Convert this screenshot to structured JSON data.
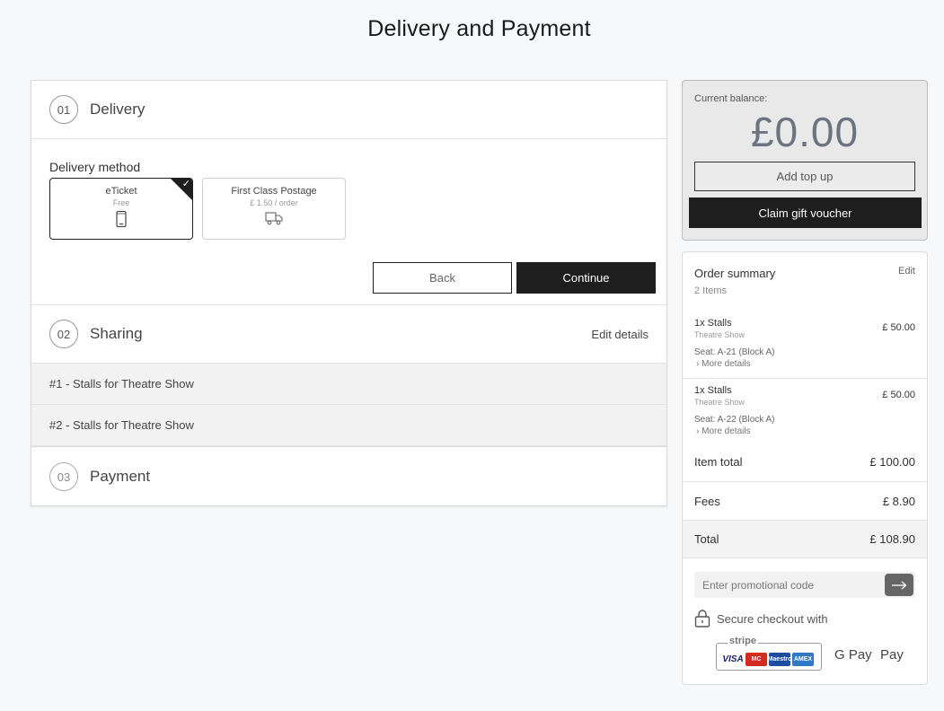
{
  "page": {
    "title": "Delivery and Payment"
  },
  "steps": {
    "delivery": {
      "number": "01",
      "title": "Delivery",
      "method_label": "Delivery method",
      "options": [
        {
          "name": "eTicket",
          "price": "Free",
          "icon": "mobile-phone-icon",
          "selected": true
        },
        {
          "name": "First Class Postage",
          "price": "£ 1.50 / order",
          "icon": "delivery-truck-icon",
          "selected": false
        }
      ],
      "back_label": "Back",
      "continue_label": "Continue"
    },
    "sharing": {
      "number": "02",
      "title": "Sharing",
      "edit_label": "Edit details",
      "tickets": [
        "#1 - Stalls for Theatre Show",
        "#2 - Stalls for Theatre Show"
      ]
    },
    "payment": {
      "number": "03",
      "title": "Payment"
    }
  },
  "balance": {
    "label": "Current balance:",
    "amount": "£0.00",
    "topup_label": "Add top up",
    "voucher_label": "Claim gift voucher"
  },
  "order_summary": {
    "title": "Order summary",
    "edit_label": "Edit",
    "count": "2 Items",
    "items": [
      {
        "name": "1x Stalls",
        "show": "Theatre Show",
        "seat": "Seat: A-21 (Block A)",
        "more": "More details",
        "price": "£ 50.00"
      },
      {
        "name": "1x Stalls",
        "show": "Theatre Show",
        "seat": "Seat: A-22 (Block A)",
        "more": "More details",
        "price": "£ 50.00"
      }
    ],
    "item_total": {
      "label": "Item total",
      "value": "£ 100.00"
    },
    "fees": {
      "label": "Fees",
      "value": "£ 8.90"
    },
    "total": {
      "label": "Total",
      "value": "£ 108.90"
    },
    "promo_placeholder": "Enter promotional code",
    "secure_text": "Secure checkout with",
    "stripe_label": "stripe",
    "card_brands": [
      "VISA",
      "MC",
      "Maestro",
      "AMEX"
    ],
    "gpay_label": "G Pay",
    "applepay_label": "Pay"
  },
  "colors": {
    "dark": "#1e1e1e",
    "balance_bg": "#e9e9e9",
    "balance_text": "#6b7480"
  }
}
